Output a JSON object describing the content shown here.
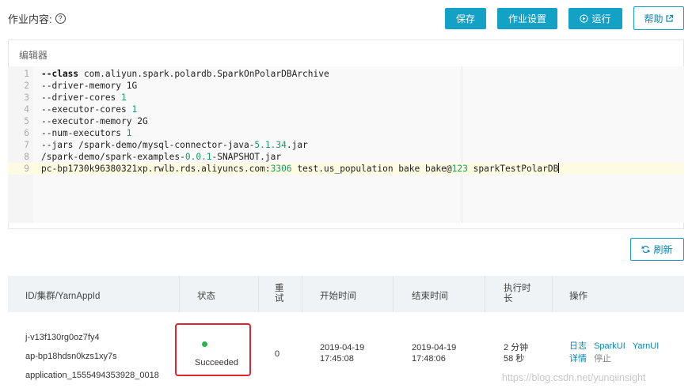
{
  "header": {
    "title": "作业内容:",
    "help_mark": "?",
    "save_label": "保存",
    "settings_label": "作业设置",
    "run_label": "运行",
    "help_label": "帮助"
  },
  "editor": {
    "label": "编辑器",
    "lines": [
      {
        "n": "1",
        "parts": [
          {
            "t": "--class",
            "c": "kw"
          },
          {
            "t": " com.aliyun.spark.polardb.SparkOnPolarDBArchive"
          }
        ]
      },
      {
        "n": "2",
        "parts": [
          {
            "t": "--driver-memory 1G"
          }
        ]
      },
      {
        "n": "3",
        "parts": [
          {
            "t": "--driver-cores "
          },
          {
            "t": "1",
            "c": "num"
          }
        ]
      },
      {
        "n": "4",
        "parts": [
          {
            "t": "--executor-cores "
          },
          {
            "t": "1",
            "c": "num"
          }
        ]
      },
      {
        "n": "5",
        "parts": [
          {
            "t": "--executor-memory 2G"
          }
        ]
      },
      {
        "n": "6",
        "parts": [
          {
            "t": "--num-executors "
          },
          {
            "t": "1",
            "c": "num"
          }
        ]
      },
      {
        "n": "7",
        "parts": [
          {
            "t": "--jars /spark-demo/mysql-connector-java-"
          },
          {
            "t": "5.1.34",
            "c": "num"
          },
          {
            "t": ".jar"
          }
        ]
      },
      {
        "n": "8",
        "parts": [
          {
            "t": "/spark-demo/spark-examples-"
          },
          {
            "t": "0.0.1",
            "c": "num"
          },
          {
            "t": "-SNAPSHOT.jar"
          }
        ]
      },
      {
        "n": "9",
        "active": true,
        "parts": [
          {
            "t": "pc-bp1730k96380321xp.rwlb.rds.aliyuncs.com:"
          },
          {
            "t": "3306",
            "c": "num"
          },
          {
            "t": " test.us_population bake bake@"
          },
          {
            "t": "123",
            "c": "num"
          },
          {
            "t": " sparkTestPolarDB"
          }
        ]
      }
    ]
  },
  "refresh_label": "刷新",
  "table": {
    "headers": {
      "id": "ID/集群/YarnAppId",
      "status": "状态",
      "retry_1": "重",
      "retry_2": "试",
      "start": "开始时间",
      "end": "结束时间",
      "duration_1": "执行时",
      "duration_2": "长",
      "actions": "操作"
    },
    "row": {
      "job_id": "j-v13f130rg0oz7fy4",
      "cluster_id": "ap-bp18hdsn0kzs1xy7s",
      "app_id": "application_1555494353928_0018",
      "status": "Succeeded",
      "retry": "0",
      "start_date": "2019-04-19",
      "start_time": "17:45:08",
      "end_date": "2019-04-19",
      "end_time": "17:48:06",
      "duration_1": "2 分钟",
      "duration_2": "58 秒",
      "action_log": "日志",
      "action_sparkui": "SparkUI",
      "action_yarnui": "YarnUI",
      "action_detail": "详情",
      "action_stop": "停止"
    }
  },
  "colors": {
    "primary": "#14a1c6",
    "success": "#2ab24b",
    "highlight": "#e0252f"
  },
  "watermark": "https://blog.csdn.net/yunqiinsight"
}
